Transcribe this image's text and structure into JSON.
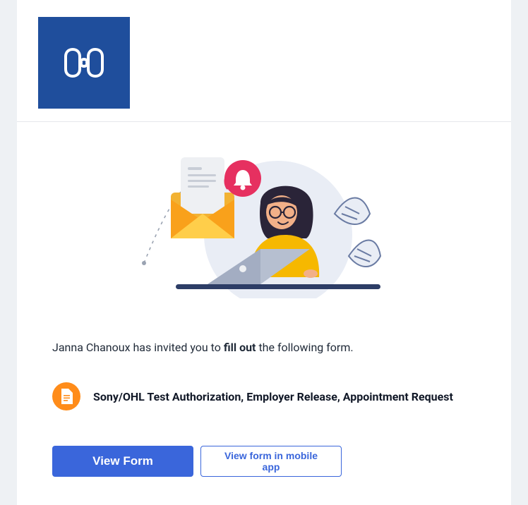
{
  "header": {
    "logo_name": "company-logo"
  },
  "invite": {
    "prefix": "Janna Chanoux has invited you to ",
    "strong": "fill out",
    "suffix": " the following form."
  },
  "form": {
    "title": "Sony/OHL Test Authorization, Employer Release, Appointment Request"
  },
  "buttons": {
    "primary": "View Form",
    "secondary": "View form in mobile app"
  }
}
